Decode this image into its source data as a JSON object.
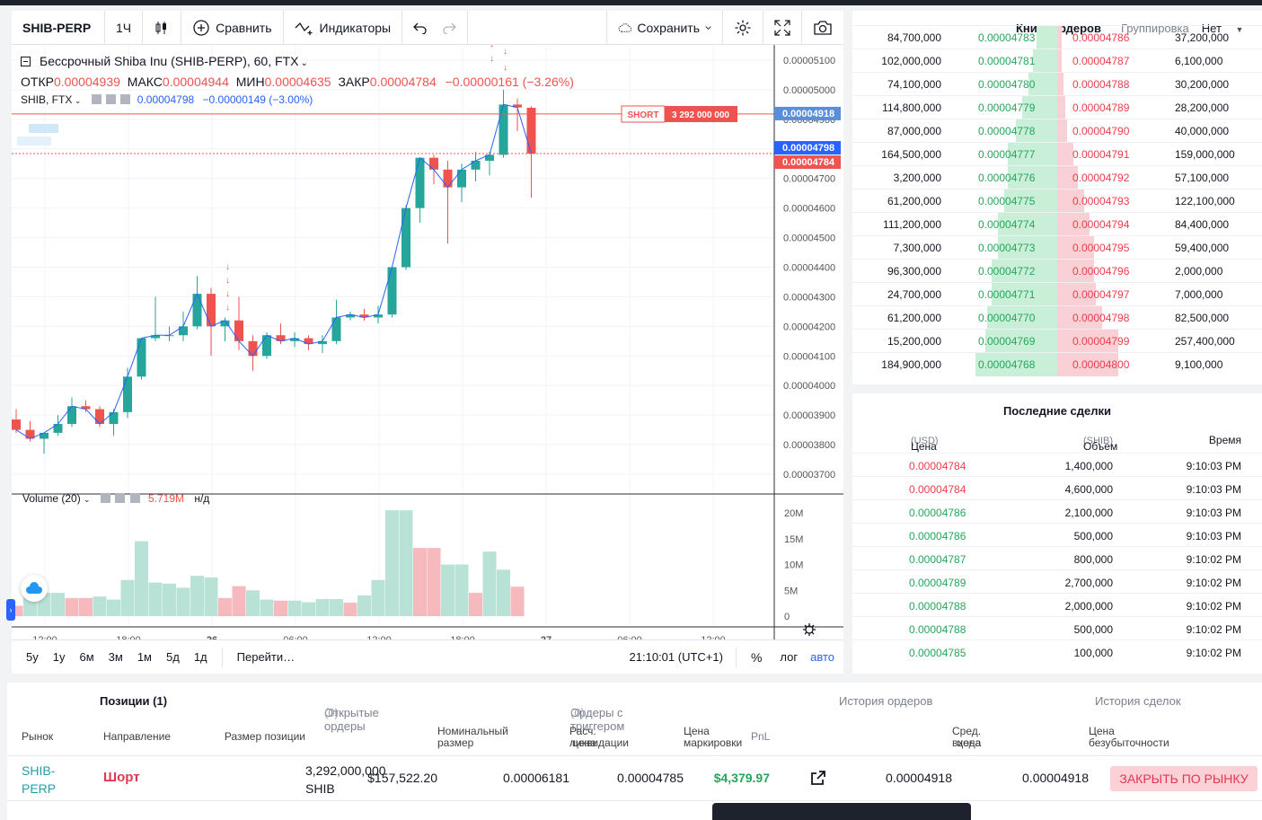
{
  "toolbar": {
    "symbol": "SHIB-PERP",
    "interval": "1Ч",
    "compare": "Сравнить",
    "indicators": "Индикаторы",
    "save": "Сохранить"
  },
  "legend": {
    "title": "Бессрочный Shiba Inu (SHIB-PERP), 60, FTX",
    "open_label": "ОТКР",
    "open": "0.00004939",
    "high_label": "МАКС",
    "high": "0.00004944",
    "low_label": "МИН",
    "low": "0.00004635",
    "close_label": "ЗАКР",
    "close": "0.00004784",
    "change": "−0.00000161 (−3.26%)",
    "sub_name": "SHIB, FTX",
    "sub_value": "0.00004798",
    "sub_change": "−0.00000149 (−3.00%)"
  },
  "volume": {
    "label": "Volume (20)",
    "value": "5.719M",
    "na": "н/д"
  },
  "price_axis": [
    "0.00005100",
    "0.00005000",
    "0.00004900",
    "0.00004800",
    "0.00004700",
    "0.00004600",
    "0.00004500",
    "0.00004400",
    "0.00004300",
    "0.00004200",
    "0.00004100",
    "0.00004000",
    "0.00003900",
    "0.00003800",
    "0.00003700"
  ],
  "price_tags": {
    "entry": "0.00004918",
    "last": "0.00004798",
    "mark": "0.00004784"
  },
  "short_tag": {
    "label": "SHORT",
    "size": "3 292 000 000"
  },
  "volume_axis": [
    "20M",
    "15M",
    "10M",
    "5M",
    "0"
  ],
  "time_axis": [
    "12:00",
    "18:00",
    "26",
    "06:00",
    "12:00",
    "18:00",
    "27",
    "06:00",
    "12:00"
  ],
  "bottom_bar": {
    "ranges": [
      "5y",
      "1y",
      "6м",
      "3м",
      "1м",
      "5д",
      "1д"
    ],
    "goto": "Перейти…",
    "clock": "21:10:01 (UTC+1)",
    "percent": "%",
    "log": "лог",
    "auto": "авто"
  },
  "chart_data": {
    "type": "candlestick",
    "candles": [
      {
        "o": 3.885,
        "h": 3.92,
        "l": 3.84,
        "c": 3.85
      },
      {
        "o": 3.85,
        "h": 3.88,
        "l": 3.81,
        "c": 3.82
      },
      {
        "o": 3.82,
        "h": 3.84,
        "l": 3.77,
        "c": 3.84
      },
      {
        "o": 3.84,
        "h": 3.9,
        "l": 3.83,
        "c": 3.87
      },
      {
        "o": 3.87,
        "h": 3.96,
        "l": 3.86,
        "c": 3.93
      },
      {
        "o": 3.93,
        "h": 3.95,
        "l": 3.91,
        "c": 3.92
      },
      {
        "o": 3.92,
        "h": 3.93,
        "l": 3.86,
        "c": 3.87
      },
      {
        "o": 3.87,
        "h": 3.92,
        "l": 3.83,
        "c": 3.91
      },
      {
        "o": 3.91,
        "h": 4.06,
        "l": 3.89,
        "c": 4.03
      },
      {
        "o": 4.03,
        "h": 4.16,
        "l": 4.02,
        "c": 4.16
      },
      {
        "o": 4.16,
        "h": 4.3,
        "l": 4.15,
        "c": 4.17
      },
      {
        "o": 4.17,
        "h": 4.2,
        "l": 4.15,
        "c": 4.17
      },
      {
        "o": 4.17,
        "h": 4.25,
        "l": 4.15,
        "c": 4.2
      },
      {
        "o": 4.2,
        "h": 4.37,
        "l": 4.19,
        "c": 4.31
      },
      {
        "o": 4.31,
        "h": 4.33,
        "l": 4.1,
        "c": 4.2
      },
      {
        "o": 4.2,
        "h": 4.23,
        "l": 4.15,
        "c": 4.22
      },
      {
        "o": 4.22,
        "h": 4.3,
        "l": 4.12,
        "c": 4.15
      },
      {
        "o": 4.15,
        "h": 4.17,
        "l": 4.05,
        "c": 4.1
      },
      {
        "o": 4.1,
        "h": 4.18,
        "l": 4.09,
        "c": 4.17
      },
      {
        "o": 4.17,
        "h": 4.21,
        "l": 4.14,
        "c": 4.15
      },
      {
        "o": 4.15,
        "h": 4.18,
        "l": 4.13,
        "c": 4.16
      },
      {
        "o": 4.16,
        "h": 4.17,
        "l": 4.12,
        "c": 4.14
      },
      {
        "o": 4.14,
        "h": 4.17,
        "l": 4.11,
        "c": 4.15
      },
      {
        "o": 4.15,
        "h": 4.29,
        "l": 4.14,
        "c": 4.23
      },
      {
        "o": 4.23,
        "h": 4.25,
        "l": 4.22,
        "c": 4.24
      },
      {
        "o": 4.24,
        "h": 4.26,
        "l": 4.22,
        "c": 4.23
      },
      {
        "o": 4.23,
        "h": 4.27,
        "l": 4.21,
        "c": 4.24
      },
      {
        "o": 4.24,
        "h": 4.4,
        "l": 4.23,
        "c": 4.4
      },
      {
        "o": 4.4,
        "h": 4.61,
        "l": 4.39,
        "c": 4.6
      },
      {
        "o": 4.6,
        "h": 4.77,
        "l": 4.55,
        "c": 4.77
      },
      {
        "o": 4.77,
        "h": 4.78,
        "l": 4.68,
        "c": 4.73
      },
      {
        "o": 4.73,
        "h": 4.76,
        "l": 4.48,
        "c": 4.67
      },
      {
        "o": 4.67,
        "h": 4.75,
        "l": 4.62,
        "c": 4.73
      },
      {
        "o": 4.73,
        "h": 4.79,
        "l": 4.69,
        "c": 4.76
      },
      {
        "o": 4.76,
        "h": 4.79,
        "l": 4.71,
        "c": 4.78
      },
      {
        "o": 4.78,
        "h": 5.0,
        "l": 4.77,
        "c": 4.95
      },
      {
        "o": 4.95,
        "h": 4.97,
        "l": 4.86,
        "c": 4.94
      },
      {
        "o": 4.939,
        "h": 4.944,
        "l": 4.635,
        "c": 4.784
      }
    ],
    "volumes": [
      2.0,
      4.5,
      4.5,
      4.5,
      3.5,
      3.5,
      3.8,
      3.2,
      7.0,
      14.5,
      6.5,
      6.3,
      5.5,
      7.8,
      7.5,
      3.5,
      5.8,
      5.0,
      3.2,
      3.0,
      3.0,
      2.7,
      3.3,
      3.3,
      2.6,
      4.0,
      7.0,
      20.5,
      20.5,
      13.2,
      13.2,
      10.0,
      10.0,
      4.5,
      12.5,
      9.0,
      5.7
    ],
    "vol_up": [
      false,
      true,
      true,
      true,
      false,
      false,
      true,
      true,
      true,
      true,
      true,
      true,
      true,
      true,
      true,
      false,
      false,
      true,
      true,
      false,
      true,
      true,
      true,
      true,
      false,
      true,
      true,
      true,
      true,
      false,
      false,
      true,
      true,
      false,
      true,
      true,
      false
    ],
    "y_unit": "1e-5",
    "ylim": [
      3.67,
      5.12
    ],
    "vol_ylim": [
      0,
      21
    ]
  },
  "orderbook": {
    "title": "Книга ордеров",
    "grouping_label": "Группировка",
    "grouping_value": "Нет",
    "rows": [
      {
        "bid_size": "84,700,000",
        "bid": "0.00004783",
        "ask": "0.00004786",
        "ask_size": "37,200,000",
        "bid_depth": 0.1,
        "ask_depth": 0.02
      },
      {
        "bid_size": "102,000,000",
        "bid": "0.00004781",
        "ask": "0.00004787",
        "ask_size": "6,100,000",
        "bid_depth": 0.12,
        "ask_depth": 0.02
      },
      {
        "bid_size": "74,100,000",
        "bid": "0.00004780",
        "ask": "0.00004788",
        "ask_size": "30,200,000",
        "bid_depth": 0.14,
        "ask_depth": 0.03
      },
      {
        "bid_size": "114,800,000",
        "bid": "0.00004779",
        "ask": "0.00004789",
        "ask_size": "28,200,000",
        "bid_depth": 0.17,
        "ask_depth": 0.04
      },
      {
        "bid_size": "87,000,000",
        "bid": "0.00004778",
        "ask": "0.00004790",
        "ask_size": "40,000,000",
        "bid_depth": 0.2,
        "ask_depth": 0.05
      },
      {
        "bid_size": "164,500,000",
        "bid": "0.00004777",
        "ask": "0.00004791",
        "ask_size": "159,000,000",
        "bid_depth": 0.24,
        "ask_depth": 0.08
      },
      {
        "bid_size": "3,200,000",
        "bid": "0.00004776",
        "ask": "0.00004792",
        "ask_size": "57,100,000",
        "bid_depth": 0.24,
        "ask_depth": 0.1
      },
      {
        "bid_size": "61,200,000",
        "bid": "0.00004775",
        "ask": "0.00004793",
        "ask_size": "122,100,000",
        "bid_depth": 0.26,
        "ask_depth": 0.13
      },
      {
        "bid_size": "111,200,000",
        "bid": "0.00004774",
        "ask": "0.00004794",
        "ask_size": "84,400,000",
        "bid_depth": 0.29,
        "ask_depth": 0.16
      },
      {
        "bid_size": "7,300,000",
        "bid": "0.00004773",
        "ask": "0.00004795",
        "ask_size": "59,400,000",
        "bid_depth": 0.29,
        "ask_depth": 0.18
      },
      {
        "bid_size": "96,300,000",
        "bid": "0.00004772",
        "ask": "0.00004796",
        "ask_size": "2,000,000",
        "bid_depth": 0.32,
        "ask_depth": 0.18
      },
      {
        "bid_size": "24,700,000",
        "bid": "0.00004771",
        "ask": "0.00004797",
        "ask_size": "7,000,000",
        "bid_depth": 0.32,
        "ask_depth": 0.19
      },
      {
        "bid_size": "61,200,000",
        "bid": "0.00004770",
        "ask": "0.00004798",
        "ask_size": "82,500,000",
        "bid_depth": 0.34,
        "ask_depth": 0.22
      },
      {
        "bid_size": "15,200,000",
        "bid": "0.00004769",
        "ask": "0.00004799",
        "ask_size": "257,400,000",
        "bid_depth": 0.35,
        "ask_depth": 0.3
      },
      {
        "bid_size": "184,900,000",
        "bid": "0.00004768",
        "ask": "0.00004800",
        "ask_size": "9,100,000",
        "bid_depth": 0.4,
        "ask_depth": 0.3
      }
    ]
  },
  "trades": {
    "title": "Последние сделки",
    "col_price": "Цена",
    "col_price_unit": "(USD)",
    "col_size": "Объем",
    "col_size_unit": "(SHIB)",
    "col_time": "Время",
    "rows": [
      {
        "price": "0.00004784",
        "size": "1,400,000",
        "time": "9:10:03 PM",
        "side": "dn"
      },
      {
        "price": "0.00004784",
        "size": "4,600,000",
        "time": "9:10:03 PM",
        "side": "dn"
      },
      {
        "price": "0.00004786",
        "size": "2,100,000",
        "time": "9:10:03 PM",
        "side": "up"
      },
      {
        "price": "0.00004786",
        "size": "500,000",
        "time": "9:10:03 PM",
        "side": "up"
      },
      {
        "price": "0.00004787",
        "size": "800,000",
        "time": "9:10:02 PM",
        "side": "up"
      },
      {
        "price": "0.00004789",
        "size": "2,700,000",
        "time": "9:10:02 PM",
        "side": "up"
      },
      {
        "price": "0.00004788",
        "size": "2,000,000",
        "time": "9:10:02 PM",
        "side": "up"
      },
      {
        "price": "0.00004788",
        "size": "500,000",
        "time": "9:10:02 PM",
        "side": "up"
      },
      {
        "price": "0.00004785",
        "size": "100,000",
        "time": "9:10:02 PM",
        "side": "up"
      }
    ]
  },
  "positions": {
    "tabs": {
      "positions": "Позиции (1)",
      "open_orders": "Открытые ордеры",
      "open_orders_count": "(0)",
      "trigger": "Ордеры с триггером",
      "trigger_count": "(0)",
      "order_history": "История ордеров",
      "trade_history": "История сделок"
    },
    "headers": {
      "market": "Рынок",
      "side": "Направление",
      "size": "Размер позиции",
      "notional_1": "Номинальный",
      "notional_2": "размер",
      "liq_1": "Расч. цена",
      "liq_2": "ликвидации",
      "mark_1": "Цена",
      "mark_2": "маркировки",
      "pnl": "PnL",
      "entry_1": "Сред. цена",
      "entry_2": "входа",
      "be_1": "Цена",
      "be_2": "безубыточности"
    },
    "row": {
      "market_1": "SHIB-",
      "market_2": "PERP",
      "side": "Шорт",
      "size_1": "3,292,000,000",
      "size_2": "SHIB",
      "notional": "$157,522.20",
      "liq": "0.00006181",
      "mark": "0.00004785",
      "pnl": "$4,379.97",
      "entry": "0.00004918",
      "breakeven": "0.00004918"
    },
    "close_button": "ЗАКРЫТЬ ПО РЫНКУ"
  }
}
